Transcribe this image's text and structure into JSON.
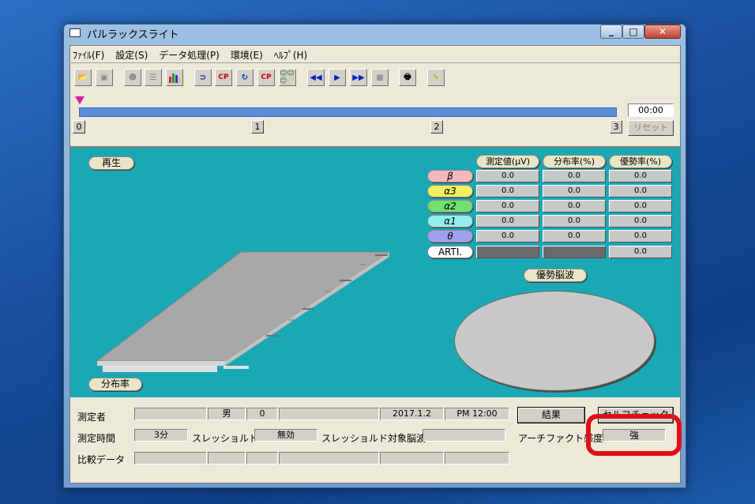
{
  "window": {
    "title": "パルラックスライト"
  },
  "menu": [
    "ﾌｧｲﾙ(F)",
    "設定(S)",
    "データ処理(P)",
    "環境(E)",
    "ﾍﾙﾌﾟ(H)"
  ],
  "playback": {
    "time": "00:00",
    "reset_label": "リセット",
    "markers": [
      "0",
      "1",
      "2",
      "3"
    ]
  },
  "panel": {
    "play_label": "再生",
    "headers": [
      "測定値(μV)",
      "分布率(%)",
      "優勢率(%)"
    ],
    "rows": [
      {
        "label": "β",
        "color": "#f4b8c0",
        "values": [
          "0.0",
          "0.0",
          "0.0"
        ]
      },
      {
        "label": "α3",
        "color": "#f0f060",
        "values": [
          "0.0",
          "0.0",
          "0.0"
        ]
      },
      {
        "label": "α2",
        "color": "#70e070",
        "values": [
          "0.0",
          "0.0",
          "0.0"
        ]
      },
      {
        "label": "α1",
        "color": "#90f0f0",
        "values": [
          "0.0",
          "0.0",
          "0.0"
        ]
      },
      {
        "label": "θ",
        "color": "#a0a0f0",
        "values": [
          "0.0",
          "0.0",
          "0.0"
        ]
      },
      {
        "label": "ARTI.",
        "color": "#ffffff",
        "values": [
          "",
          "",
          "0.0"
        ]
      }
    ],
    "dominant_label": "優勢脳波",
    "distribution_label": "分布率"
  },
  "info": {
    "measurer_label": "測定者",
    "measurer_fields": [
      "",
      "男",
      "0",
      "",
      "2017.1.2",
      "PM 12:00"
    ],
    "result_button": "結果",
    "self_check_button": "セルフチェック",
    "time_label": "測定時間",
    "time_value": "3分",
    "threshold_label": "スレッショルド",
    "threshold_value": "無効",
    "threshold_target_label": "スレッショルド対象脳波",
    "threshold_target_value": "",
    "artifact_label": "アーチファクト感度",
    "artifact_value": "強",
    "compare_label": "比較データ"
  },
  "colors": {
    "panel": "#1aa8b4",
    "progress": "#5b8fd8",
    "highlight": "#e0101a"
  }
}
